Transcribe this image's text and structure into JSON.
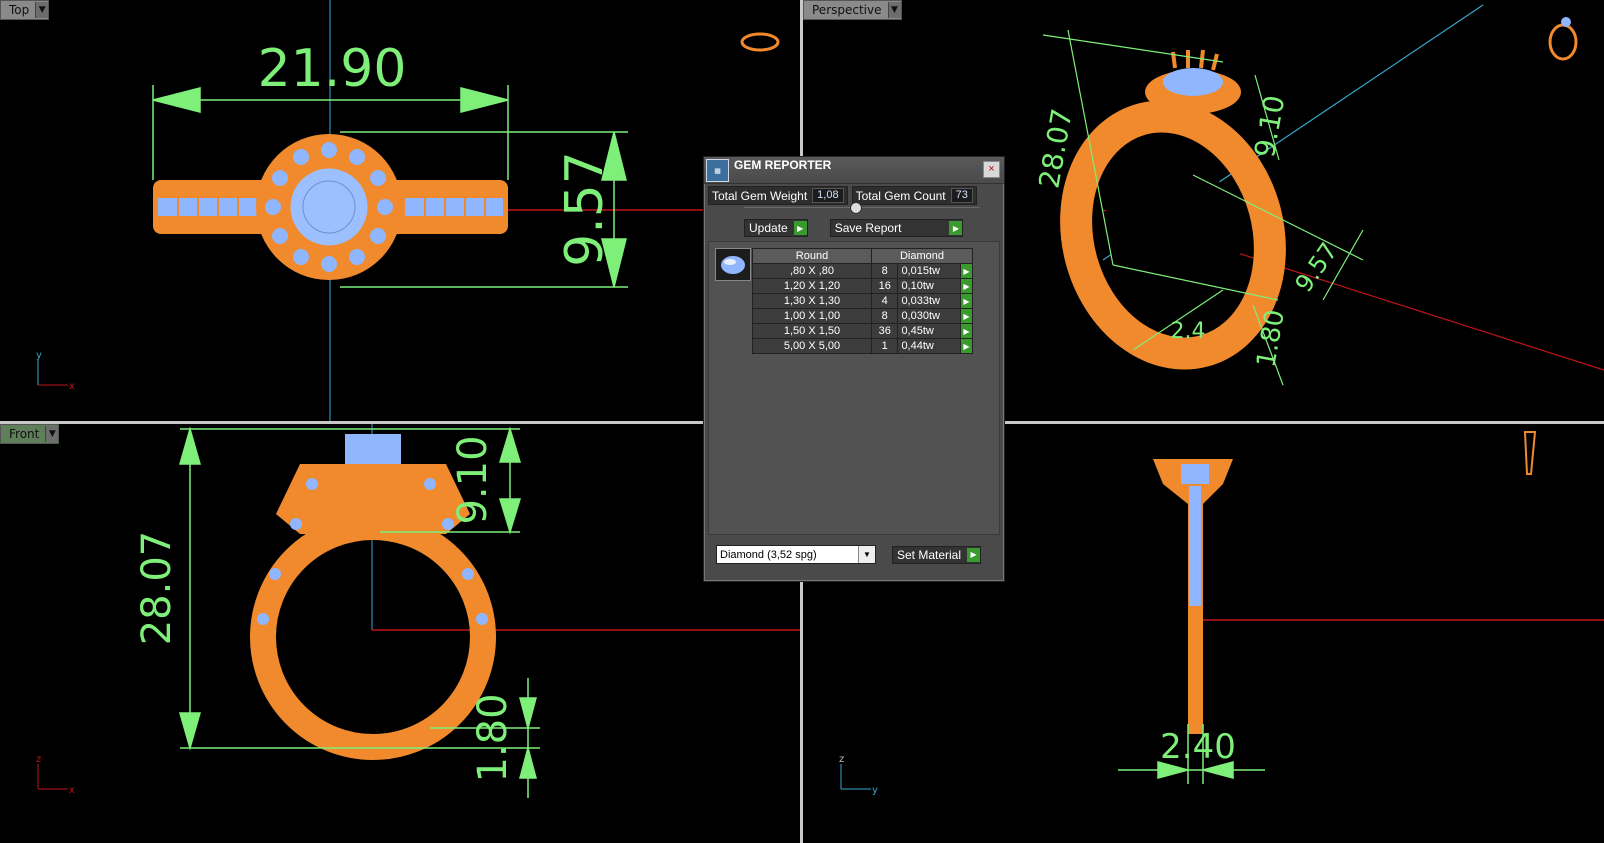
{
  "viewports": {
    "top": {
      "label": "Top",
      "dims": {
        "width": "21.90",
        "height": "9.57"
      },
      "axis": {
        "v": "y",
        "h": "x"
      }
    },
    "perspective": {
      "label": "Perspective",
      "dims": {
        "height": "28.07",
        "top": "9.10",
        "mid": "9.57",
        "bottom": "1.80",
        "shank": "2.4"
      }
    },
    "front": {
      "label": "Front",
      "dims": {
        "height": "28.07",
        "top": "9.10",
        "bottom": "1.80"
      },
      "axis": {
        "v": "z",
        "h": "x"
      }
    },
    "right": {
      "dims": {
        "width": "2.40"
      },
      "axis": {
        "v": "z",
        "h": "y"
      }
    }
  },
  "gem_reporter": {
    "title": "GEM REPORTER",
    "close": "×",
    "total_weight_label": "Total Gem Weight",
    "total_weight_value": "1,08",
    "total_count_label": "Total Gem Count",
    "total_count_value": "73",
    "update_label": "Update",
    "save_report_label": "Save Report",
    "table": {
      "headers": [
        "Round",
        "Diamond"
      ],
      "rows": [
        {
          "size": ",80 X ,80",
          "count": "8",
          "weight": "0,015tw"
        },
        {
          "size": "1,20 X 1,20",
          "count": "16",
          "weight": "0,10tw"
        },
        {
          "size": "1,30 X 1,30",
          "count": "4",
          "weight": "0,033tw"
        },
        {
          "size": "1,00 X 1,00",
          "count": "8",
          "weight": "0,030tw"
        },
        {
          "size": "1,50 X 1,50",
          "count": "36",
          "weight": "0,45tw"
        },
        {
          "size": "5,00 X 5,00",
          "count": "1",
          "weight": "0,44tw"
        }
      ]
    },
    "material_select": "Diamond    (3,52 spg)",
    "set_material_label": "Set Material"
  },
  "colors": {
    "dimension": "#7ef07a",
    "metal": "#f08a2c",
    "gem": "#8fb6ff",
    "axis_x": "#c0141a",
    "axis_y": "#3aa6d0"
  }
}
